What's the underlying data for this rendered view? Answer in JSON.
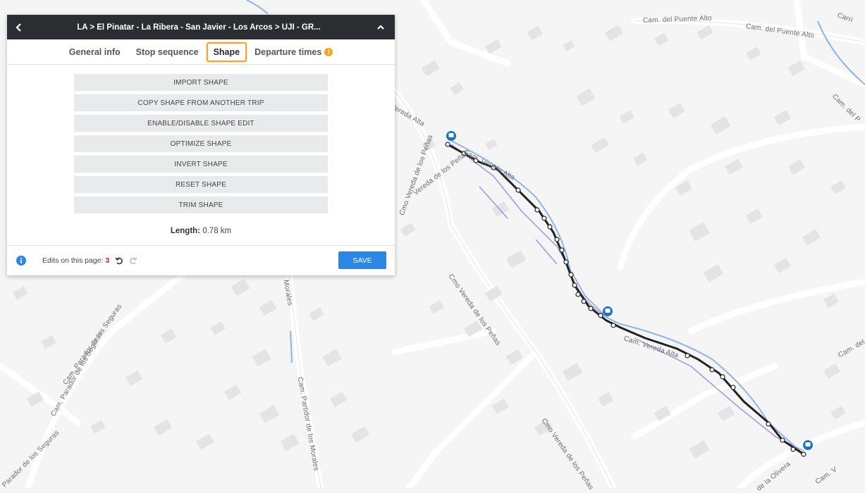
{
  "panel": {
    "title": "LA > El Pinatar - La Ribera - San Javier - Los Arcos > UJI - GR...",
    "tabs": [
      {
        "label": "General info"
      },
      {
        "label": "Stop sequence"
      },
      {
        "label": "Shape"
      },
      {
        "label": "Departure times"
      }
    ],
    "active_tab": "Shape",
    "warning_glyph": "!",
    "actions": [
      "IMPORT SHAPE",
      "COPY SHAPE FROM ANOTHER TRIP",
      "ENABLE/DISABLE SHAPE EDIT",
      "OPTIMIZE SHAPE",
      "INVERT SHAPE",
      "RESET SHAPE",
      "TRIM SHAPE"
    ],
    "length_label": "Length:",
    "length_value": "0.78 km",
    "edits_label": "Edits on this page:",
    "edits_count": "3",
    "save_label": "SAVE"
  },
  "map": {
    "road_labels": [
      "Cam. del Puente Alto",
      "Cam. del Puente Alto",
      "Cam. del P",
      "Cam. del Pu",
      "Carri",
      "Vereda Alta",
      "Vereda de los Peñas",
      "Cmo Vereda de los Peñas",
      "Cmo Vereda de los Peñas",
      "Cmo Vereda de los Peñas",
      "Cam. Vereda Alta",
      "Cam. Vereda Alta",
      "Cam. Parador de los Seguras",
      "Cam. Parador de los Seguras",
      "Parador de los Seguras",
      "Cam. Partidor de los Morales",
      "Morales",
      "de la Olivera",
      "Cam. V"
    ],
    "colors": {
      "route": "#222222",
      "route_alt": "#8a7fe0",
      "road_blue": "#8fb4e8",
      "stop": "#1a73c8"
    }
  }
}
